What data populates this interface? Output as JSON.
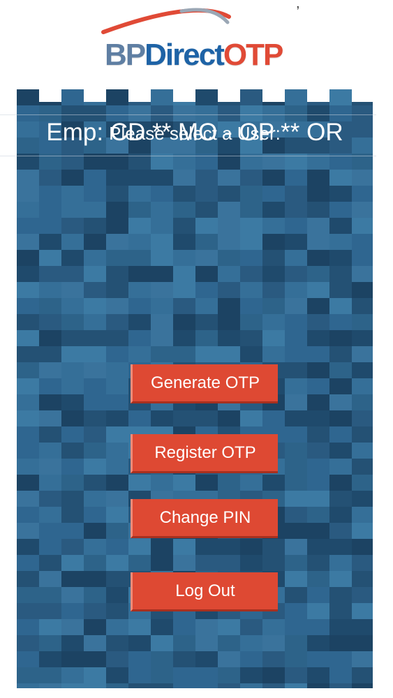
{
  "status_bar": {
    "fragment": ","
  },
  "logo": {
    "bp": "BP",
    "direct": "Direct",
    "otp": "OTP",
    "colors": {
      "bp": "#5f7fa3",
      "direct": "#1e63a6",
      "otp": "#e04a36",
      "arc_red": "#e04a36",
      "arc_grey": "#9aa7b5"
    }
  },
  "panel": {
    "prompt": "Please select a User:",
    "selected_user": "Emp: CD ** MO - OP ** OR",
    "background_color": "#2c5f86"
  },
  "buttons": {
    "generate": "Generate OTP",
    "register": "Register OTP",
    "change_pin": "Change PIN",
    "logout": "Log Out",
    "color": "#de4933"
  }
}
